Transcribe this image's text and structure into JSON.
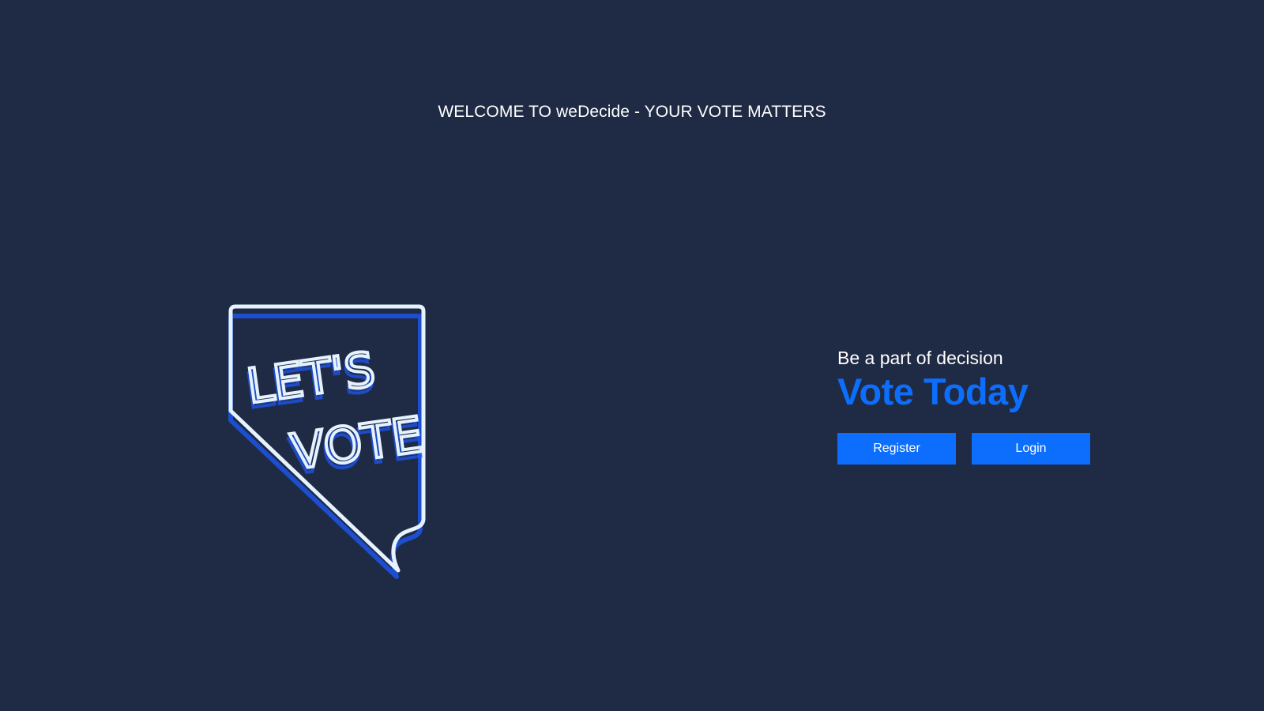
{
  "header": {
    "welcome_text": "WELCOME TO weDecide - YOUR VOTE MATTERS"
  },
  "hero_image": {
    "line1": "LET'S",
    "line2": "VOTE",
    "icon": "neon-nevada-sign"
  },
  "cta": {
    "tagline": "Be a part of decision",
    "headline": "Vote Today",
    "register_label": "Register",
    "login_label": "Login"
  },
  "colors": {
    "background": "#1f2a44",
    "accent": "#0d6efd",
    "text": "#ffffff",
    "neon": "#e6f3ff",
    "neon_glow": "#1e5bff"
  }
}
